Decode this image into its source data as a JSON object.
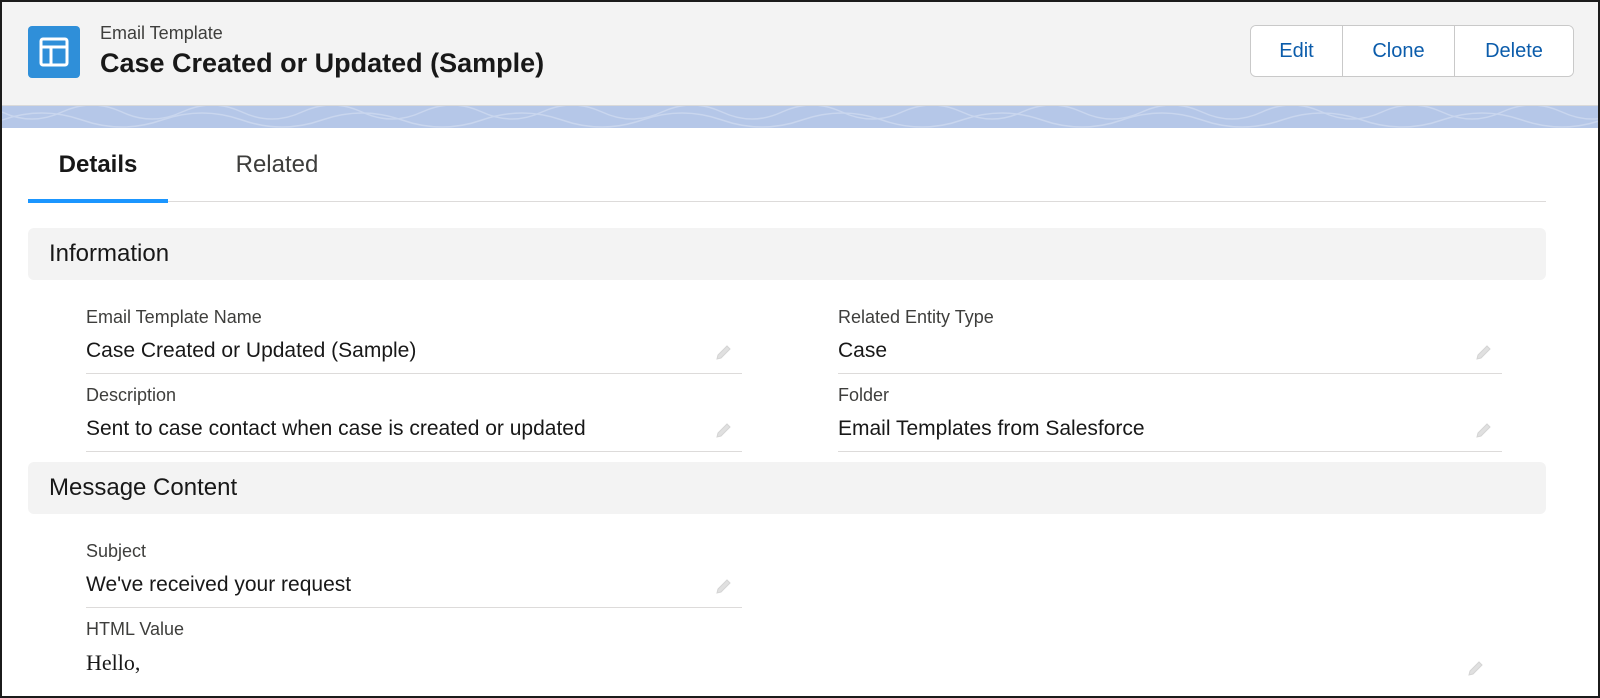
{
  "header": {
    "object_label": "Email Template",
    "record_title": "Case Created or Updated (Sample)",
    "icon": "email-template-icon",
    "icon_color": "#2f8fd9",
    "actions": {
      "edit": "Edit",
      "clone": "Clone",
      "delete": "Delete"
    }
  },
  "tabs": {
    "details": "Details",
    "related": "Related",
    "active": "Details"
  },
  "sections": {
    "information": {
      "title": "Information",
      "fields": {
        "email_template_name": {
          "label": "Email Template Name",
          "value": "Case Created or Updated (Sample)"
        },
        "description": {
          "label": "Description",
          "value": "Sent to case contact when case is created or updated"
        },
        "related_entity_type": {
          "label": "Related Entity Type",
          "value": "Case"
        },
        "folder": {
          "label": "Folder",
          "value": "Email Templates from Salesforce"
        }
      }
    },
    "message_content": {
      "title": "Message Content",
      "fields": {
        "subject": {
          "label": "Subject",
          "value": "We've received your request"
        },
        "html_value": {
          "label": "HTML Value",
          "value": "Hello,"
        }
      }
    }
  },
  "colors": {
    "accent": "#1b96ff",
    "link": "#0b5cab",
    "banner": "#b5c7e8"
  }
}
